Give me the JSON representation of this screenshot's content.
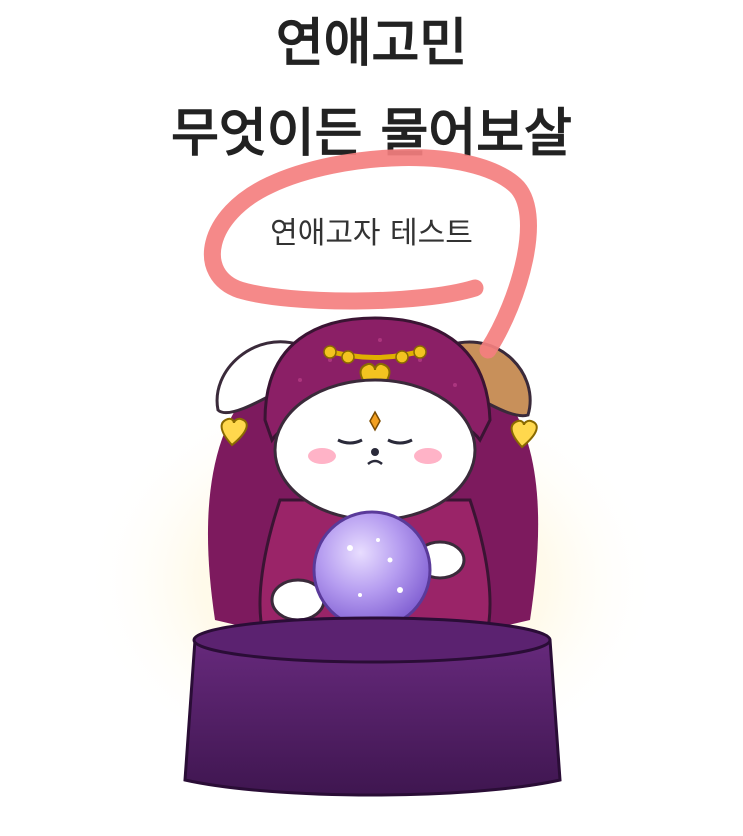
{
  "header": {
    "title_line_1": "연애고민",
    "title_line_2": "무엇이든 물어보살",
    "subtitle": "연애고자 테스트"
  },
  "illustration": {
    "subject": "fortune-teller-dog-with-crystal-ball",
    "icon": "crystal-ball-icon"
  },
  "colors": {
    "title_text": "#222222",
    "annotation_stroke": "#f47f7f",
    "hood": "#8b1f66",
    "crystal_ball": "#a98ee8",
    "stand": "#4e1d61"
  }
}
